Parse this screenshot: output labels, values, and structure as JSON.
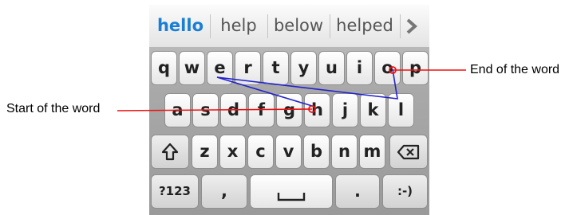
{
  "suggestions": [
    "hello",
    "help",
    "below",
    "helped"
  ],
  "suggest_more_icon": "chevron-right-icon",
  "rows": [
    [
      "q",
      "w",
      "e",
      "r",
      "t",
      "y",
      "u",
      "i",
      "o",
      "p"
    ],
    [
      "a",
      "s",
      "d",
      "f",
      "g",
      "h",
      "j",
      "k",
      "l"
    ],
    [
      "z",
      "x",
      "c",
      "v",
      "b",
      "n",
      "m"
    ]
  ],
  "bottom": {
    "numbers": "?123",
    "comma": ",",
    "period": ".",
    "smiley": ":-)"
  },
  "shift_icon": "shift-icon",
  "backspace_icon": "backspace-icon",
  "space_icon": "spacebar-icon",
  "annotations": {
    "start": "Start of the word",
    "end": "End of the word"
  },
  "colors": {
    "swipe_path": "#2222cc",
    "callout": "#ee1111",
    "suggest_active": "#1a7fd4"
  }
}
